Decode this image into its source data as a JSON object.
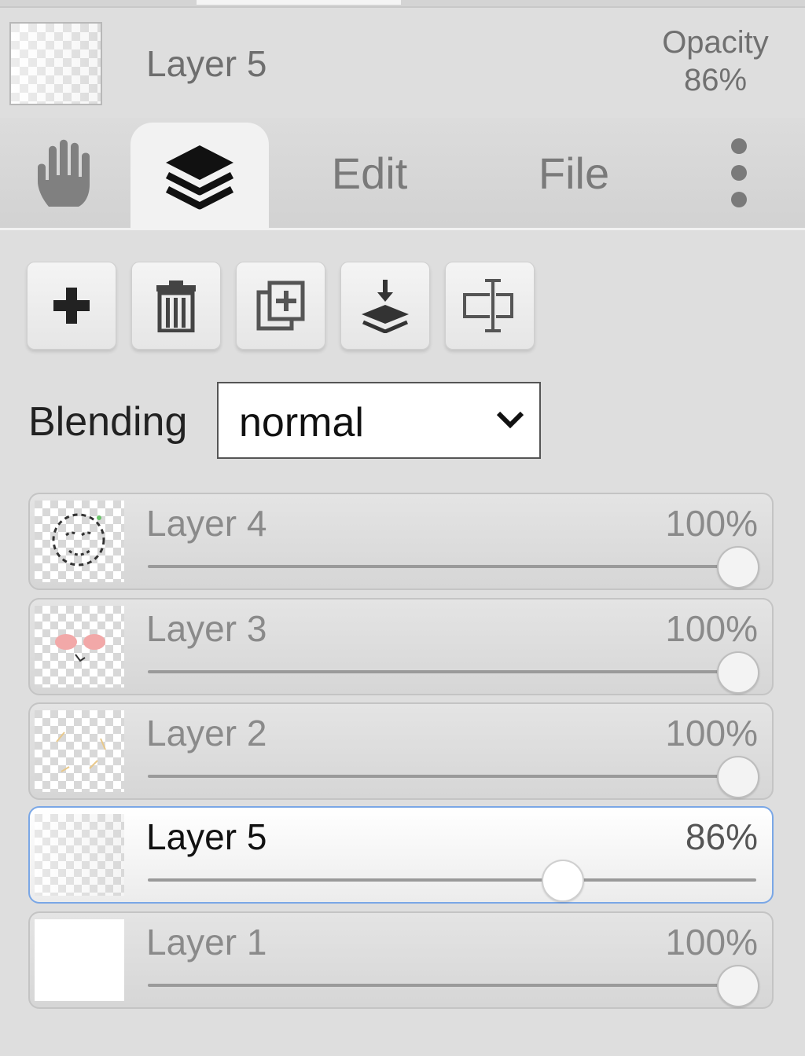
{
  "header": {
    "layer_name": "Layer 5",
    "opacity_label": "Opacity",
    "opacity_value": "86%"
  },
  "tabs": [
    {
      "name": "hand",
      "icon": "hand-icon"
    },
    {
      "name": "layers",
      "icon": "layers-icon",
      "active": true
    },
    {
      "name": "edit",
      "label": "Edit"
    },
    {
      "name": "file",
      "label": "File"
    },
    {
      "name": "more",
      "icon": "more-vertical-icon"
    }
  ],
  "toolbar": {
    "buttons": [
      {
        "name": "add-layer-button",
        "icon": "plus-icon"
      },
      {
        "name": "delete-layer-button",
        "icon": "trash-icon"
      },
      {
        "name": "duplicate-layer-button",
        "icon": "duplicate-icon"
      },
      {
        "name": "merge-down-button",
        "icon": "merge-down-icon"
      },
      {
        "name": "rename-layer-button",
        "icon": "rename-icon"
      }
    ]
  },
  "blending": {
    "label": "Blending",
    "value": "normal"
  },
  "layers": [
    {
      "name": "Layer 4",
      "opacity_text": "100%",
      "opacity": 100,
      "active": false
    },
    {
      "name": "Layer 3",
      "opacity_text": "100%",
      "opacity": 100,
      "active": false
    },
    {
      "name": "Layer 2",
      "opacity_text": "100%",
      "opacity": 100,
      "active": false
    },
    {
      "name": "Layer 5",
      "opacity_text": "86%",
      "opacity": 86,
      "active": true
    },
    {
      "name": "Layer 1",
      "opacity_text": "100%",
      "opacity": 100,
      "active": false
    }
  ],
  "colors": {
    "active_border": "#7aa7e6",
    "panel_bg": "#dedede"
  }
}
